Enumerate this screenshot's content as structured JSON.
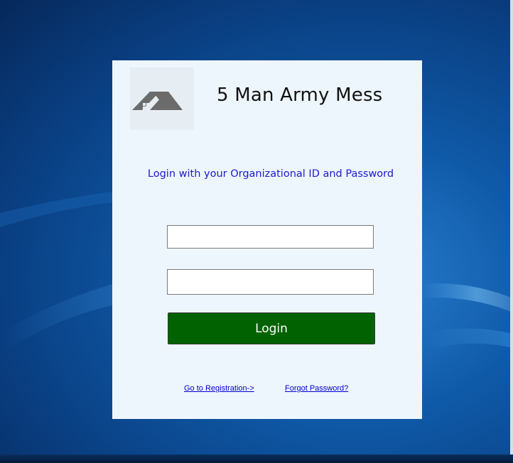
{
  "app": {
    "title": "5 Man Army Mess",
    "logo_icon": "house-roof-icon"
  },
  "login": {
    "instruction": "Login with your Organizational ID and Password",
    "username_value": "",
    "password_value": "",
    "button_label": "Login"
  },
  "links": {
    "registration": "Go to Registration->",
    "forgot_password": "Forgot Password?"
  },
  "colors": {
    "panel_background": "#eef6fd",
    "instruction_text": "#1a1ad0",
    "login_button": "#006200",
    "link_text": "#0000cc",
    "logo_gray": "#6b6b6b"
  }
}
